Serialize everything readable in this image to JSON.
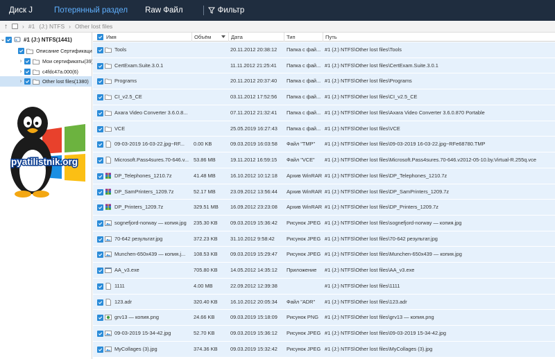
{
  "topbar": {
    "tabs": [
      {
        "label": "Диск J"
      },
      {
        "label": "Потерянный раздел"
      },
      {
        "label": "Raw Файл"
      }
    ],
    "filter_label": "Фильтр"
  },
  "breadcrumb": {
    "drive": "#1",
    "partition": "(J:) NTFS",
    "folder": "Other lost files"
  },
  "tree": {
    "root": {
      "label": "#1  (J:) NTFS(1441)"
    },
    "items": [
      {
        "label": "Описание Сертификаци"
      },
      {
        "label": "Мои сертификаты(39)"
      },
      {
        "label": "c4fdc47a.000(6)"
      },
      {
        "label": "Other lost files(1380)"
      }
    ],
    "logo_text": "pyatilistnik.org"
  },
  "columns": {
    "name": "Имя",
    "size": "Объём",
    "date": "Дата",
    "type": "Тип",
    "path": "Путь"
  },
  "files": [
    {
      "icon": "folder-icon",
      "name": "Tools",
      "size": "",
      "date": "20.11.2012 20:38:12",
      "type": "Папка с фай...",
      "path": "#1  (J:) NTFS\\Other lost files\\Tools"
    },
    {
      "icon": "folder-icon",
      "name": "CertExam.Suite.3.0.1",
      "size": "",
      "date": "11.11.2012 21:25:41",
      "type": "Папка с фай...",
      "path": "#1  (J:) NTFS\\Other lost files\\CertExam.Suite.3.0.1"
    },
    {
      "icon": "folder-icon",
      "name": "Programs",
      "size": "",
      "date": "20.11.2012 20:37:40",
      "type": "Папка с фай...",
      "path": "#1  (J:) NTFS\\Other lost files\\Programs"
    },
    {
      "icon": "folder-icon",
      "name": "CI_v2.5_CE",
      "size": "",
      "date": "03.11.2012 17:52:56",
      "type": "Папка с фай...",
      "path": "#1  (J:) NTFS\\Other lost files\\CI_v2.5_CE"
    },
    {
      "icon": "folder-icon",
      "name": "Axara Video Converter 3.6.0.8...",
      "size": "",
      "date": "07.11.2012 21:32:41",
      "type": "Папка с фай...",
      "path": "#1  (J:) NTFS\\Other lost files\\Axara Video Converter 3.6.0.870 Portable"
    },
    {
      "icon": "folder-icon",
      "name": "VCE",
      "size": "",
      "date": "25.05.2019 16:27:43",
      "type": "Папка с фай...",
      "path": "#1  (J:) NTFS\\Other lost files\\VCE"
    },
    {
      "icon": "file-icon",
      "name": "09-03-2019 16-03-22.jpg~RF...",
      "size": "0.00 KB",
      "date": "09.03.2019 16:03:58",
      "type": "Файл \"TMP\"",
      "path": "#1  (J:) NTFS\\Other lost files\\09-03-2019 16-03-22.jpg~RFe68780.TMP"
    },
    {
      "icon": "file-icon",
      "name": "Microsoft.Pass4sures.70-646.v...",
      "size": "53.86 MB",
      "date": "19.11.2012 16:59:15",
      "type": "Файл \"VCE\"",
      "path": "#1  (J:) NTFS\\Other lost files\\Microsoft.Pass4sures.70-646.v2012-05-10.by.Virtual-R.255q.vce"
    },
    {
      "icon": "archive-icon",
      "name": "DP_Telephones_1210.7z",
      "size": "41.48 MB",
      "date": "16.10.2012 10:12:18",
      "type": "Архив WinRAR",
      "path": "#1  (J:) NTFS\\Other lost files\\DP_Telephones_1210.7z"
    },
    {
      "icon": "archive-icon",
      "name": "DP_SamPrinters_1209.7z",
      "size": "52.17 MB",
      "date": "23.09.2012 13:56:44",
      "type": "Архив WinRAR",
      "path": "#1  (J:) NTFS\\Other lost files\\DP_SamPrinters_1209.7z"
    },
    {
      "icon": "archive-icon",
      "name": "DP_Printers_1209.7z",
      "size": "329.51 MB",
      "date": "16.09.2012 23:23:08",
      "type": "Архив WinRAR",
      "path": "#1  (J:) NTFS\\Other lost files\\DP_Printers_1209.7z"
    },
    {
      "icon": "image-icon",
      "name": "sognefjord-norway — копия.jpg",
      "size": "235.30 KB",
      "date": "09.03.2019 15:36:42",
      "type": "Рисунок JPEG",
      "path": "#1  (J:) NTFS\\Other lost files\\sognefjord-norway — копия.jpg"
    },
    {
      "icon": "image-icon",
      "name": "70-642 результат.jpg",
      "size": "372.23 KB",
      "date": "31.10.2012 9:58:42",
      "type": "Рисунок JPEG",
      "path": "#1  (J:) NTFS\\Other lost files\\70-642 результат.jpg"
    },
    {
      "icon": "image-icon",
      "name": "Munchen-650x439 — копия.j...",
      "size": "108.53 KB",
      "date": "09.03.2019 15:29:47",
      "type": "Рисунок JPEG",
      "path": "#1  (J:) NTFS\\Other lost files\\Munchen-650x439 — копия.jpg"
    },
    {
      "icon": "exe-icon",
      "name": "AA_v3.exe",
      "size": "705.80 KB",
      "date": "14.05.2012 14:35:12",
      "type": "Приложение",
      "path": "#1  (J:) NTFS\\Other lost files\\AA_v3.exe"
    },
    {
      "icon": "file-icon",
      "name": "1111",
      "size": "4.00 MB",
      "date": "22.09.2012 12:39:38",
      "type": "",
      "path": "#1  (J:) NTFS\\Other lost files\\1111"
    },
    {
      "icon": "file-icon",
      "name": "123.adr",
      "size": "320.40 KB",
      "date": "16.10.2012 20:05:34",
      "type": "Файл \"ADR\"",
      "path": "#1  (J:) NTFS\\Other lost files\\123.adr"
    },
    {
      "icon": "png-icon",
      "name": "grv13 — копия.png",
      "size": "24.66 KB",
      "date": "09.03.2019 15:18:09",
      "type": "Рисунок PNG",
      "path": "#1  (J:) NTFS\\Other lost files\\grv13 — копия.png"
    },
    {
      "icon": "image-icon",
      "name": "09-03-2019 15-34-42.jpg",
      "size": "52.70 KB",
      "date": "09.03.2019 15:36:12",
      "type": "Рисунок JPEG",
      "path": "#1  (J:) NTFS\\Other lost files\\09-03-2019 15-34-42.jpg"
    },
    {
      "icon": "image-icon",
      "name": "MyCollages (3).jpg",
      "size": "374.36 KB",
      "date": "09.03.2019 15:32:42",
      "type": "Рисунок JPEG",
      "path": "#1  (J:) NTFS\\Other lost files\\MyCollages (3).jpg"
    }
  ],
  "colors": {
    "topbar_bg": "#1f2d3f",
    "active_tab": "#5fb0ff",
    "checkbox": "#2a8bd8",
    "row_bg": "#e6f1fc",
    "selected_tree": "#cfe3f6"
  }
}
